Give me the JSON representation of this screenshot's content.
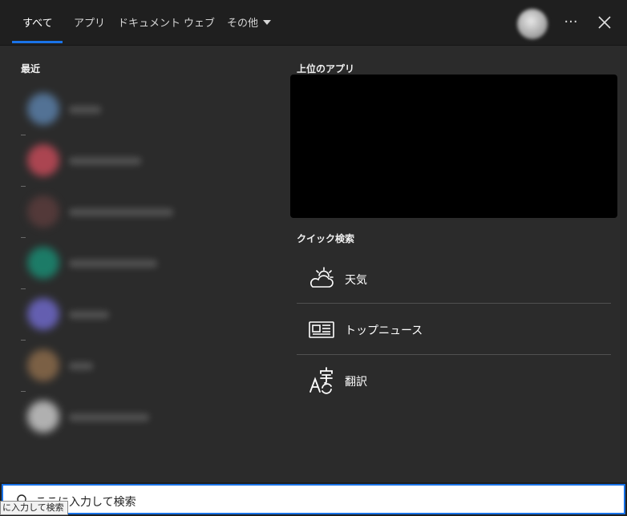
{
  "tabs": [
    {
      "label": "すべて"
    },
    {
      "label": "アプリ"
    },
    {
      "label": "ドキュメント"
    },
    {
      "label": "ウェブ"
    },
    {
      "label": "その他"
    }
  ],
  "header": {
    "more_label": "···"
  },
  "recent": {
    "title": "最近",
    "item_colors": [
      "#5a7fa8",
      "#c24a58",
      "#5a3c3c",
      "#1a8a72",
      "#6e68c8",
      "#8a6a4a",
      "#c8c8c8"
    ]
  },
  "top_apps": {
    "title": "上位のアプリ"
  },
  "quick_search": {
    "title": "クイック検索",
    "items": [
      {
        "label": "天気",
        "icon": "weather-icon"
      },
      {
        "label": "トップニュース",
        "icon": "news-icon"
      },
      {
        "label": "翻訳",
        "icon": "translate-icon"
      }
    ]
  },
  "search": {
    "placeholder": "ここに入力して検索"
  },
  "tooltip": {
    "text": "に入力して検索"
  },
  "colors": {
    "accent": "#1a73e8",
    "panel": "#2b2b2b",
    "tabbar": "#1f1f1f"
  }
}
